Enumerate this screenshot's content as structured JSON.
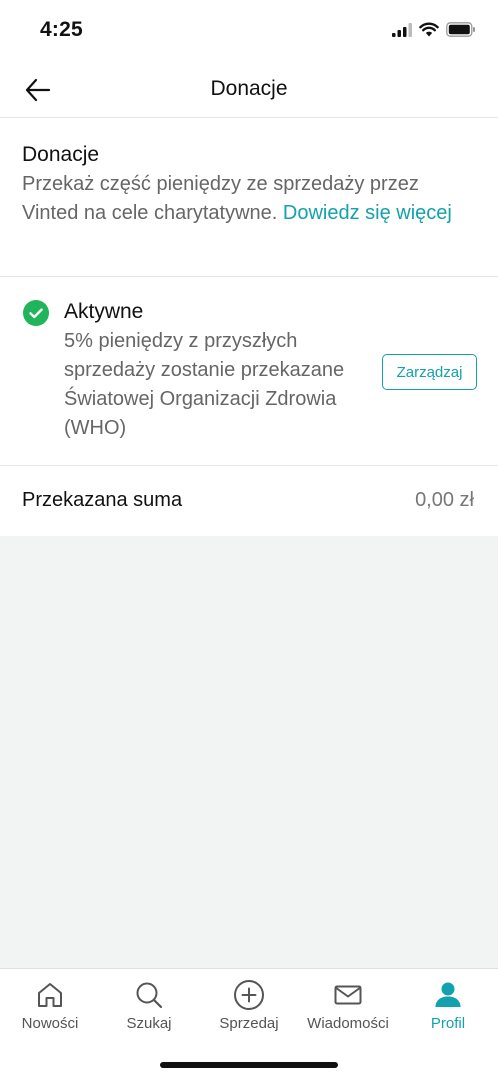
{
  "status_bar": {
    "time": "4:25"
  },
  "header": {
    "title": "Donacje",
    "back_icon": "arrow-left-icon"
  },
  "intro": {
    "title": "Donacje",
    "description": "Przekaż część pieniędzy ze sprzedaży przez Vinted na cele charytatywne.",
    "link": "Dowiedz się więcej"
  },
  "status": {
    "title": "Aktywne",
    "description": "5% pieniędzy z przyszłych sprzedaży zostanie przekazane Światowej Organizacji Zdrowia (WHO)",
    "manage_label": "Zarządzaj",
    "icon": "check-circle-icon"
  },
  "summary": {
    "label": "Przekazana suma",
    "value": "0,00 zł"
  },
  "tabs": [
    {
      "label": "Nowości",
      "icon": "home-icon"
    },
    {
      "label": "Szukaj",
      "icon": "search-icon"
    },
    {
      "label": "Sprzedaj",
      "icon": "plus-circle-icon"
    },
    {
      "label": "Wiadomości",
      "icon": "mail-icon"
    },
    {
      "label": "Profil",
      "icon": "profile-icon"
    }
  ],
  "colors": {
    "accent": "#12a2ad",
    "success": "#20b55a",
    "background": "#f2f3f3"
  }
}
